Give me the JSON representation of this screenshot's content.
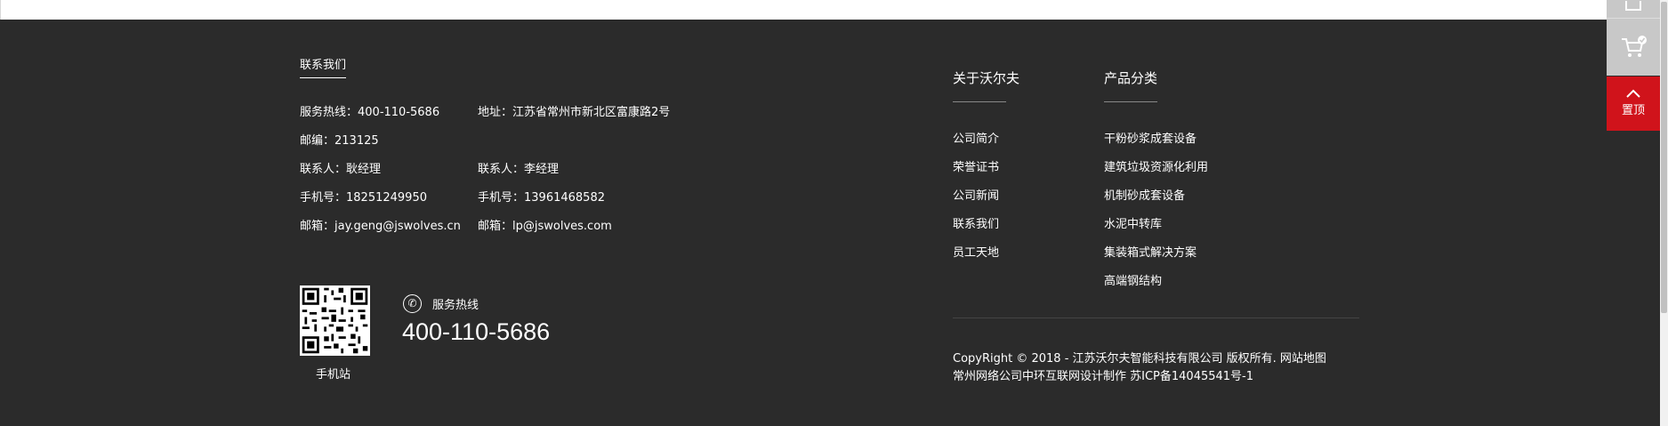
{
  "contact": {
    "title": "联系我们",
    "hotline": "服务热线：400-110-5686",
    "address": "地址：江苏省常州市新北区富康路2号",
    "postcode": "邮编：213125",
    "contact1": "联系人：耿经理",
    "contact2": "联系人：李经理",
    "mobile1": "手机号：18251249950",
    "mobile2": "手机号：13961468582",
    "email1": "邮箱：jay.geng@jswolves.cn",
    "email2": "邮箱：lp@jswolves.com"
  },
  "qr": {
    "label": "手机站"
  },
  "hotline_block": {
    "label": "服务热线",
    "number": "400-110-5686",
    "icon": "phone-icon"
  },
  "about": {
    "title": "关于沃尔夫",
    "links": [
      "公司简介",
      "荣誉证书",
      "公司新闻",
      "联系我们",
      "员工天地"
    ]
  },
  "products": {
    "title": "产品分类",
    "links": [
      "干粉砂浆成套设备",
      "建筑垃圾资源化利用",
      "机制砂成套设备",
      "水泥中转库",
      "集装箱式解决方案",
      "高端钢结构"
    ]
  },
  "copyright": {
    "line1": "CopyRight © 2018 - 江苏沃尔夫智能科技有限公司 版权所有. 网站地图",
    "line2": "常州网络公司中环互联网设计制作  苏ICP备14045541号-1"
  },
  "sidebar": {
    "cart_icon": "cart-icon",
    "top_label": "置顶",
    "colors": {
      "gray": "#c8c8c8",
      "red": "#d0131b"
    }
  },
  "colors": {
    "footer_bg": "#2b2b2b",
    "text": "#ffffff"
  }
}
